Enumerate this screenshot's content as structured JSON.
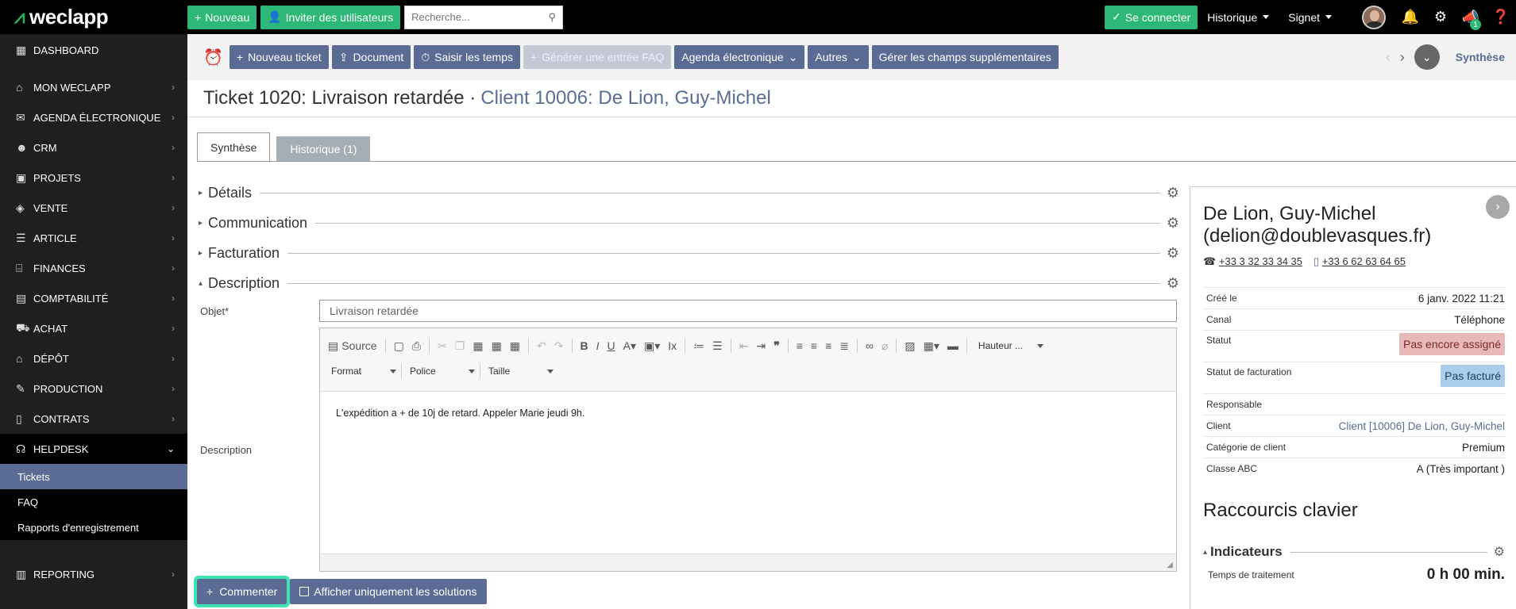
{
  "brand": {
    "name": "weclapp"
  },
  "topbar": {
    "new_label": "Nouveau",
    "invite_label": "Inviter des utilisateurs",
    "search_placeholder": "Recherche...",
    "connect_label": "Se connecter",
    "history_label": "Historique",
    "bookmark_label": "Signet",
    "notif_count": "1"
  },
  "sidebar": {
    "items": [
      {
        "label": "Dashboard",
        "icon": "dashboard-icon"
      },
      {
        "label": "Mon weclapp",
        "icon": "home-icon"
      },
      {
        "label": "Agenda électronique",
        "icon": "mail-icon"
      },
      {
        "label": "CRM",
        "icon": "users-icon"
      },
      {
        "label": "Projets",
        "icon": "briefcase-icon"
      },
      {
        "label": "Vente",
        "icon": "tag-icon"
      },
      {
        "label": "Article",
        "icon": "list-icon"
      },
      {
        "label": "Finances",
        "icon": "bank-icon"
      },
      {
        "label": "Comptabilité",
        "icon": "calculator-icon"
      },
      {
        "label": "Achat",
        "icon": "cart-icon"
      },
      {
        "label": "Dépôt",
        "icon": "warehouse-icon"
      },
      {
        "label": "Production",
        "icon": "wrench-icon"
      },
      {
        "label": "Contrats",
        "icon": "document-icon"
      },
      {
        "label": "Helpdesk",
        "icon": "headset-icon"
      }
    ],
    "sub_items": [
      "Tickets",
      "FAQ",
      "Rapports d'enregistrement"
    ],
    "reporting_label": "Reporting"
  },
  "actionbar": {
    "new_ticket": "Nouveau ticket",
    "document": "Document",
    "time": "Saisir les temps",
    "faq": "Générer une entrée FAQ",
    "agenda": "Agenda électronique",
    "others": "Autres",
    "fields": "Gérer les champs supplémentaires",
    "synthese": "Synthèse"
  },
  "title": {
    "ticket": "Ticket 1020: Livraison retardée ·",
    "client": "Client 10006: De Lion, Guy-Michel"
  },
  "tabs": [
    "Synthèse",
    "Historique (1)"
  ],
  "sections": [
    "Détails",
    "Communication",
    "Facturation",
    "Description"
  ],
  "form": {
    "objet_label": "Objet*",
    "objet_value": "Livraison retardée",
    "description_label": "Description",
    "description_text": "L'expédition a + de 10j de retard. Appeler Marie jeudi 9h."
  },
  "editor": {
    "source_label": "Source",
    "format_label": "Format",
    "police_label": "Police",
    "taille_label": "Taille",
    "hauteur_label": "Hauteur ..."
  },
  "buttons": {
    "comment": "Commenter",
    "solutions_only": "Afficher uniquement les solutions"
  },
  "contact": {
    "name": "De Lion, Guy-Michel (delion@doublevasques.fr)",
    "phone1": "+33 3 32 33 34 35",
    "phone2": "+33 6 62 63 64 65"
  },
  "details": [
    {
      "key": "Créé le",
      "value": "6 janv. 2022 11:21"
    },
    {
      "key": "Canal",
      "value": "Téléphone"
    },
    {
      "key": "Statut",
      "value": "Pas encore assigné"
    },
    {
      "key": "Statut de facturation",
      "value": "Pas facturé"
    },
    {
      "key": "Responsable",
      "value": ""
    },
    {
      "key": "Client",
      "value": "Client [10006] De Lion, Guy-Michel"
    },
    {
      "key": "Catégorie de client",
      "value": "Premium"
    },
    {
      "key": "Classe ABC",
      "value": "A (Très important )"
    }
  ],
  "shortcuts_title": "Raccourcis clavier",
  "indicators": {
    "label": "Indicateurs",
    "processing_label": "Temps de traitement",
    "processing_value": "0 h 00 min."
  },
  "colors": {
    "accent": "#5b6c94",
    "green": "#2db877",
    "highlight": "#3ee3b3"
  }
}
